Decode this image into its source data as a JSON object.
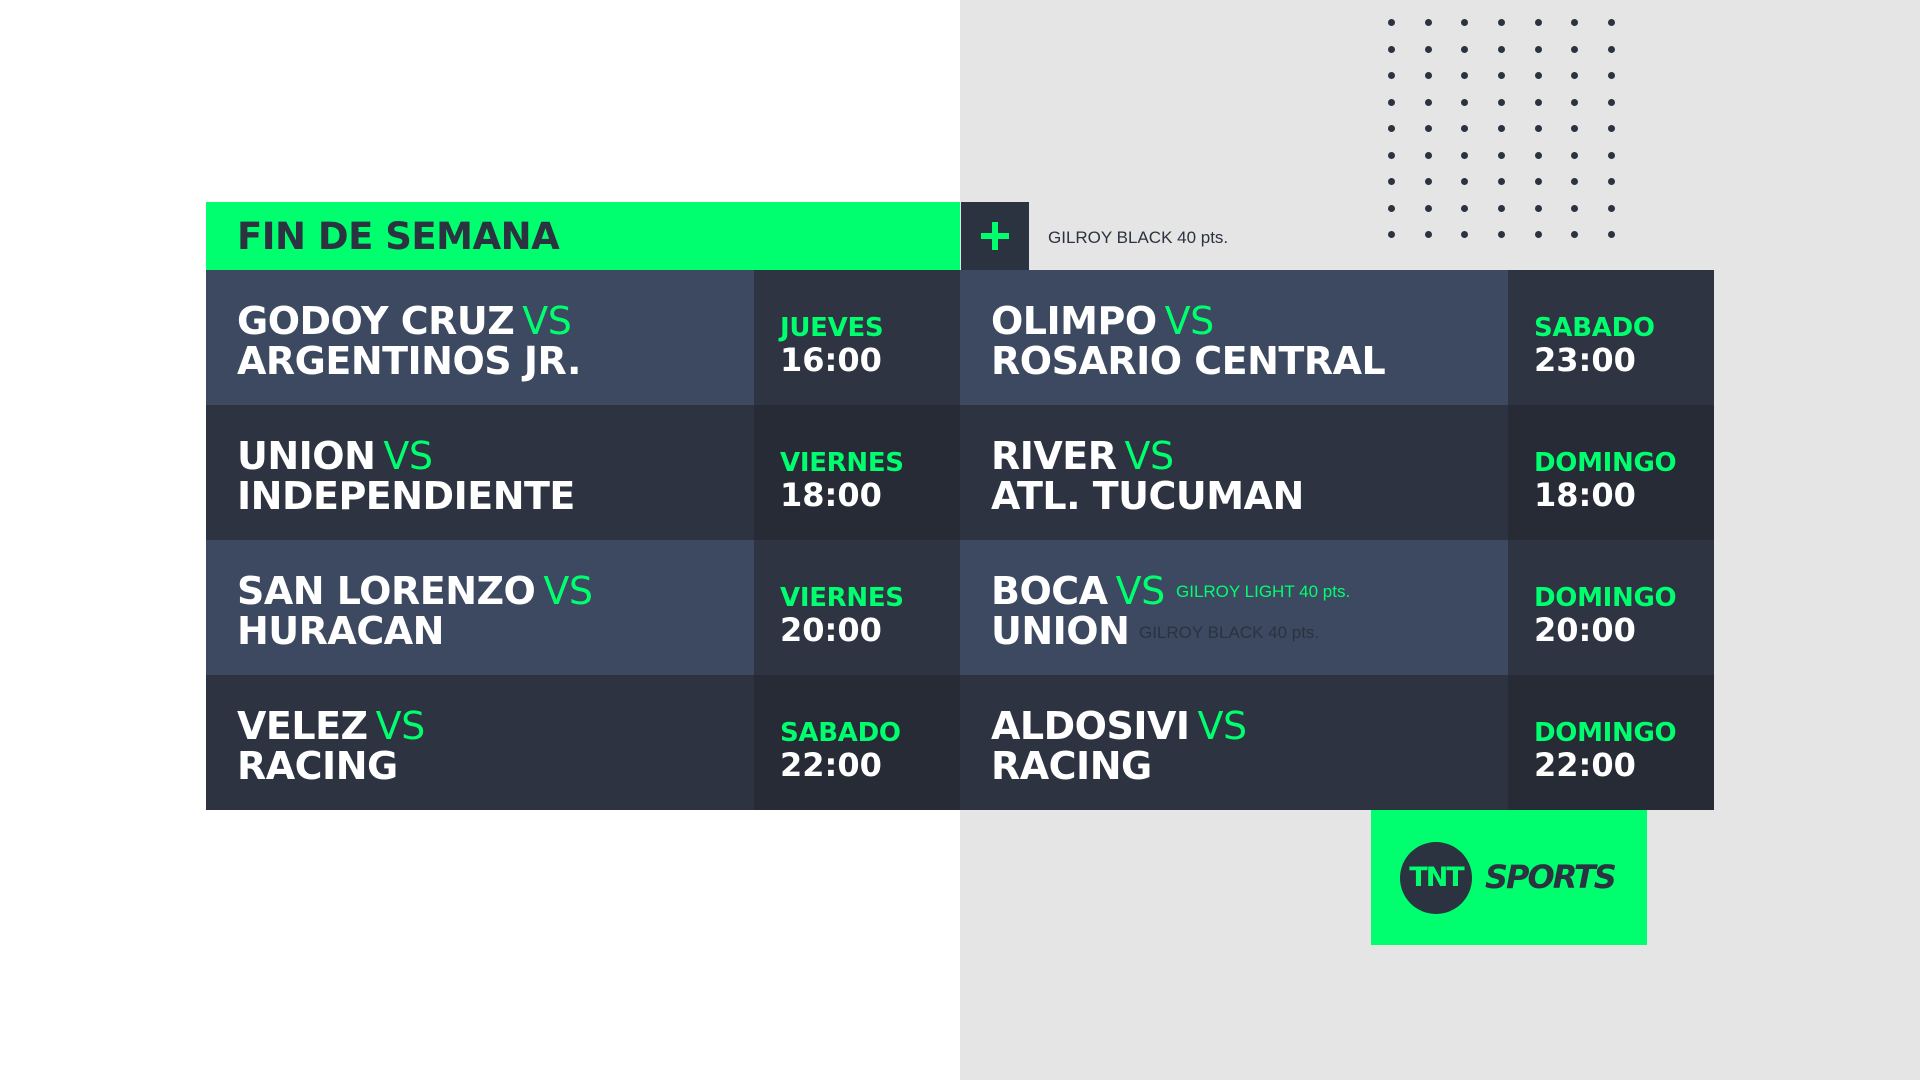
{
  "colors": {
    "accent": "#00ff6e",
    "dark": "#2b3240",
    "row_light": "#3c4960",
    "row_dark": "#2d3340",
    "time_light": "#2e3441",
    "time_dark": "#262b36",
    "background_right": "#e5e5e5"
  },
  "header": {
    "title": "FIN DE SEMANA",
    "plus_icon": "plus-icon",
    "font_note": "GILROY BLACK 40 pts."
  },
  "vs_label": "VS",
  "matches_left": [
    {
      "home": "GODOY CRUZ",
      "away": "ARGENTINOS JR.",
      "day": "JUEVES",
      "time": "16:00"
    },
    {
      "home": "UNION",
      "away": "INDEPENDIENTE",
      "day": "VIERNES",
      "time": "18:00"
    },
    {
      "home": "SAN LORENZO",
      "away": "HURACAN",
      "day": "VIERNES",
      "time": "20:00"
    },
    {
      "home": "VELEZ",
      "away": "RACING",
      "day": "SABADO",
      "time": "22:00"
    }
  ],
  "matches_right": [
    {
      "home": "OLIMPO",
      "away": "ROSARIO CENTRAL",
      "day": "SABADO",
      "time": "23:00"
    },
    {
      "home": "RIVER",
      "away": "ATL. TUCUMAN",
      "day": "DOMINGO",
      "time": "18:00"
    },
    {
      "home": "BOCA",
      "away": "UNION",
      "day": "DOMINGO",
      "time": "20:00"
    },
    {
      "home": "ALDOSIVI",
      "away": "RACING",
      "day": "DOMINGO",
      "time": "22:00"
    }
  ],
  "annotations": {
    "light_note": "GILROY LIGHT 40 pts.",
    "black_note": "GILROY BLACK 40 pts."
  },
  "logo": {
    "mark": "TNT",
    "text": "SPORTS"
  }
}
